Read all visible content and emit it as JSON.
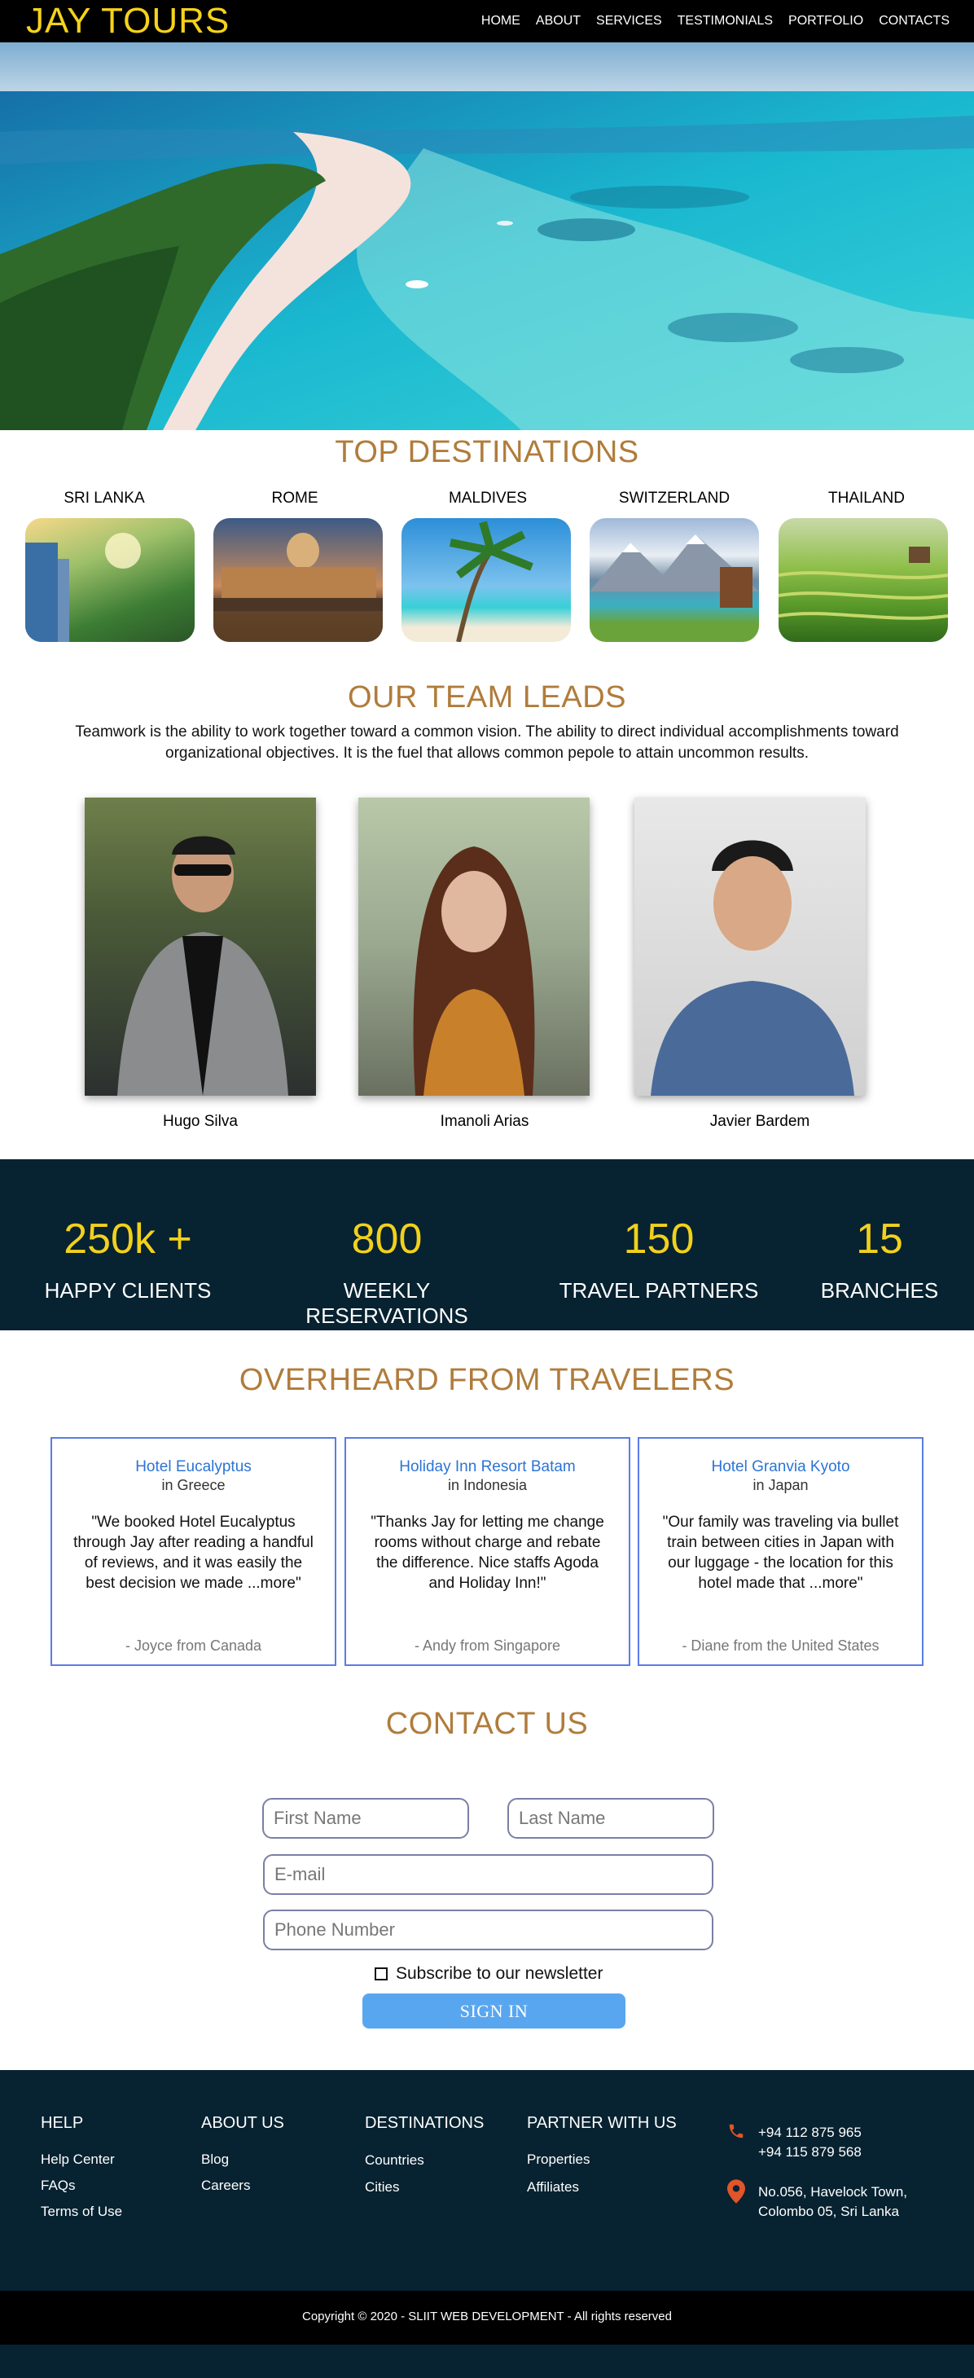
{
  "brand": "JAY TOURS",
  "nav": [
    "HOME",
    "ABOUT",
    "SERVICES",
    "TESTIMONIALS",
    "PORTFOLIO",
    "CONTACTS"
  ],
  "destinations": {
    "title": "TOP DESTINATIONS",
    "items": [
      "SRI LANKA",
      "ROME",
      "MALDIVES",
      "SWITZERLAND",
      "THAILAND"
    ]
  },
  "team": {
    "title": "OUR TEAM LEADS",
    "text": "Teamwork is the ability to work together toward a common vision. The ability to direct  individual accomplishments toward organizational objectives. It is the fuel that allows common pepole to attain uncommon results.",
    "members": [
      "Hugo Silva",
      "Imanoli Arias",
      "Javier Bardem"
    ]
  },
  "stats": [
    {
      "value": "250k +",
      "label": "HAPPY CLIENTS"
    },
    {
      "value": "800",
      "label": "WEEKLY RESERVATIONS"
    },
    {
      "value": "150",
      "label": "TRAVEL PARTNERS"
    },
    {
      "value": "15",
      "label": "BRANCHES"
    }
  ],
  "reviews": {
    "title": "OVERHEARD FROM TRAVELERS",
    "items": [
      {
        "hotel": "Hotel Eucalyptus",
        "location": "in Greece",
        "quote": "\"We booked Hotel Eucalyptus through Jay after reading a handful of reviews, and it was easily the best decision we made ...more\"",
        "author": "- Joyce from Canada"
      },
      {
        "hotel": "Holiday Inn Resort Batam",
        "location": "in Indonesia",
        "quote": "\"Thanks Jay for letting me change rooms without charge and rebate the difference. Nice staffs Agoda and Holiday Inn!\"",
        "author": "- Andy from Singapore"
      },
      {
        "hotel": "Hotel Granvia Kyoto",
        "location": "in Japan",
        "quote": "\"Our family was traveling via bullet train between cities in Japan with our luggage - the location for this hotel made that ...more\"",
        "author": "- Diane from the United States"
      }
    ]
  },
  "contact": {
    "title": "CONTACT US",
    "first_name": "First Name",
    "last_name": "Last Name",
    "email": "E-mail",
    "phone": "Phone Number",
    "subscribe": "Subscribe to our newsletter",
    "submit": "SIGN IN"
  },
  "footer": {
    "help": {
      "title": "HELP",
      "links": [
        "Help Center",
        "FAQs",
        "Terms of Use"
      ]
    },
    "about": {
      "title": "ABOUT US",
      "links": [
        "Blog",
        "Careers"
      ]
    },
    "destinations": {
      "title": "DESTINATIONS",
      "links": [
        "Countries",
        "Cities"
      ]
    },
    "partner": {
      "title": "PARTNER WITH US",
      "links": [
        "Properties",
        "Affiliates"
      ]
    },
    "phone1": "+94 112 875 965",
    "phone2": "+94 115 879 568",
    "address1": "No.056, Havelock Town,",
    "address2": "Colombo 05, Sri Lanka",
    "copyright": "Copyright © 2020 - SLIIT WEB DEVELOPMENT - All rights reserved"
  },
  "colors": {
    "accent": "#f5d21b",
    "title": "#b07c3b",
    "dark": "#072230",
    "link": "#2c74d6",
    "button": "#59a6f0"
  },
  "icons": [
    "phone-icon",
    "location-pin-icon",
    "checkbox-icon"
  ]
}
